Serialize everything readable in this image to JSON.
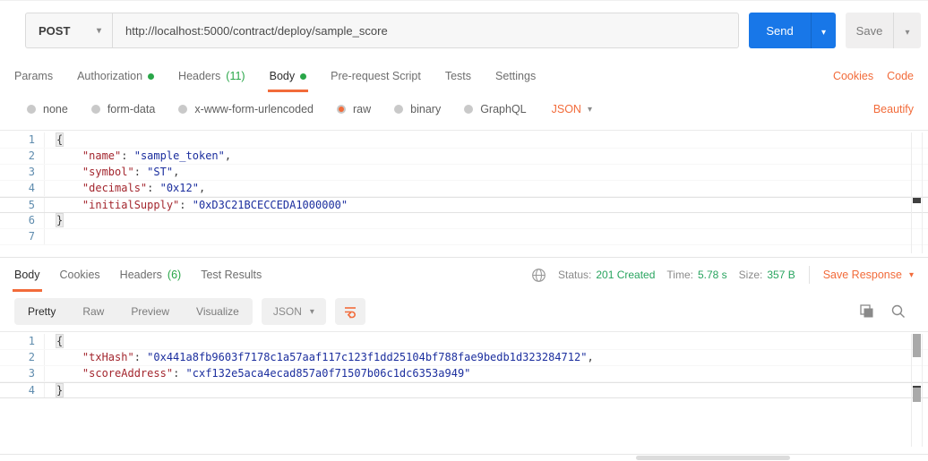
{
  "colors": {
    "accent_orange": "#F26B3A",
    "accent_blue": "#1877E8",
    "badge_green": "#29A648",
    "status_green": "#28A45F",
    "key_token": "#A3262E",
    "string_token": "#1B2E9E",
    "line_number": "#5F8CAE"
  },
  "request_bar": {
    "method": "POST",
    "url": "http://localhost:5000/contract/deploy/sample_score",
    "send_label": "Send",
    "save_label": "Save"
  },
  "request_tabs": {
    "items": [
      {
        "label": "Params"
      },
      {
        "label": "Authorization",
        "dot": true
      },
      {
        "label": "Headers",
        "count": "(11)"
      },
      {
        "label": "Body",
        "dot": true,
        "active": true
      },
      {
        "label": "Pre-request Script"
      },
      {
        "label": "Tests"
      },
      {
        "label": "Settings"
      }
    ],
    "cookies_label": "Cookies",
    "code_label": "Code"
  },
  "body_type_row": {
    "options": [
      "none",
      "form-data",
      "x-www-form-urlencoded",
      "raw",
      "binary",
      "GraphQL"
    ],
    "selected": "raw",
    "format_label": "JSON",
    "beautify_label": "Beautify"
  },
  "request_editor": {
    "editable": true,
    "lines": [
      {
        "num": "1",
        "segs": [
          {
            "c": "b",
            "t": "{"
          }
        ]
      },
      {
        "num": "2",
        "segs": [
          {
            "c": "p",
            "t": "    "
          },
          {
            "c": "k",
            "t": "\"name\""
          },
          {
            "c": "p",
            "t": ": "
          },
          {
            "c": "s",
            "t": "\"sample_token\""
          },
          {
            "c": "p",
            "t": ","
          }
        ]
      },
      {
        "num": "3",
        "segs": [
          {
            "c": "p",
            "t": "    "
          },
          {
            "c": "k",
            "t": "\"symbol\""
          },
          {
            "c": "p",
            "t": ": "
          },
          {
            "c": "s",
            "t": "\"ST\""
          },
          {
            "c": "p",
            "t": ","
          }
        ]
      },
      {
        "num": "4",
        "segs": [
          {
            "c": "p",
            "t": "    "
          },
          {
            "c": "k",
            "t": "\"decimals\""
          },
          {
            "c": "p",
            "t": ": "
          },
          {
            "c": "s",
            "t": "\"0x12\""
          },
          {
            "c": "p",
            "t": ","
          }
        ]
      },
      {
        "num": "5",
        "active": true,
        "segs": [
          {
            "c": "p",
            "t": "    "
          },
          {
            "c": "k",
            "t": "\"initialSupply\""
          },
          {
            "c": "p",
            "t": ": "
          },
          {
            "c": "s",
            "t": "\"0xD3C21BCECCEDA1000000\""
          }
        ]
      },
      {
        "num": "6",
        "segs": [
          {
            "c": "b",
            "t": "}"
          }
        ]
      },
      {
        "num": "7",
        "segs": []
      }
    ]
  },
  "response_tabs": {
    "items": [
      {
        "label": "Body",
        "active": true
      },
      {
        "label": "Cookies"
      },
      {
        "label": "Headers",
        "count": "(6)"
      },
      {
        "label": "Test Results"
      }
    ]
  },
  "response_meta": {
    "status_label": "Status:",
    "status_value": "201 Created",
    "time_label": "Time:",
    "time_value": "5.78 s",
    "size_label": "Size:",
    "size_value": "357 B",
    "save_response_label": "Save Response"
  },
  "response_view": {
    "tabs": [
      "Pretty",
      "Raw",
      "Preview",
      "Visualize"
    ],
    "active": "Pretty",
    "format_label": "JSON"
  },
  "response_editor": {
    "editable": false,
    "lines": [
      {
        "num": "1",
        "segs": [
          {
            "c": "b",
            "t": "{"
          }
        ]
      },
      {
        "num": "2",
        "segs": [
          {
            "c": "p",
            "t": "    "
          },
          {
            "c": "k",
            "t": "\"txHash\""
          },
          {
            "c": "p",
            "t": ": "
          },
          {
            "c": "s",
            "t": "\"0x441a8fb9603f7178c1a57aaf117c123f1dd25104bf788fae9bedb1d323284712\""
          },
          {
            "c": "p",
            "t": ","
          }
        ]
      },
      {
        "num": "3",
        "segs": [
          {
            "c": "p",
            "t": "    "
          },
          {
            "c": "k",
            "t": "\"scoreAddress\""
          },
          {
            "c": "p",
            "t": ": "
          },
          {
            "c": "s",
            "t": "\"cxf132e5aca4ecad857a0f71507b06c1dc6353a949\""
          }
        ]
      },
      {
        "num": "4",
        "active": true,
        "segs": [
          {
            "c": "b",
            "t": "}"
          }
        ]
      }
    ]
  }
}
